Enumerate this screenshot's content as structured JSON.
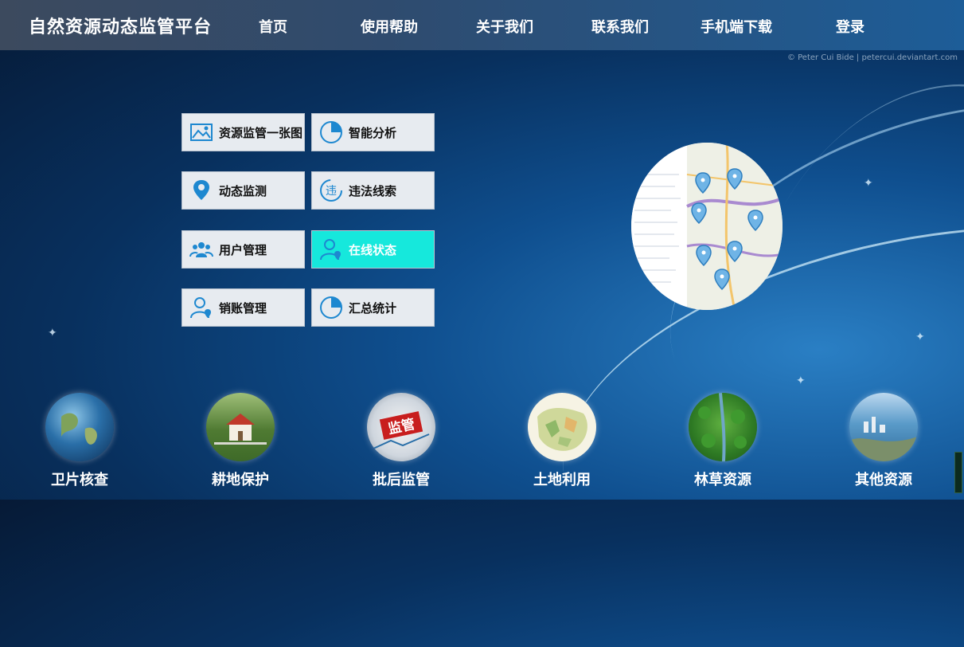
{
  "header": {
    "title": "自然资源动态监管平台",
    "nav": [
      "首页",
      "使用帮助",
      "关于我们",
      "联系我们",
      "手机端下载",
      "登录"
    ]
  },
  "credit": "© Peter Cui Bide | petercui.deviantart.com",
  "tiles": [
    {
      "label": "资源监管一张图",
      "icon": "map-image-icon"
    },
    {
      "label": "智能分析",
      "icon": "pie-chart-icon"
    },
    {
      "label": "动态监测",
      "icon": "location-pin-icon"
    },
    {
      "label": "违法线索",
      "icon": "violation-icon"
    },
    {
      "label": "用户管理",
      "icon": "users-icon"
    },
    {
      "label": "在线状态",
      "icon": "user-location-icon",
      "active": true
    },
    {
      "label": "销账管理",
      "icon": "user-location-icon"
    },
    {
      "label": "汇总统计",
      "icon": "pie-chart-icon"
    }
  ],
  "bottom": [
    "卫片核查",
    "耕地保护",
    "批后监管",
    "土地利用",
    "林草资源",
    "其他资源"
  ],
  "colors": {
    "accent": "#16e8dc",
    "icon_blue": "#1e88d0",
    "tile_bg": "#e7ebf0"
  }
}
